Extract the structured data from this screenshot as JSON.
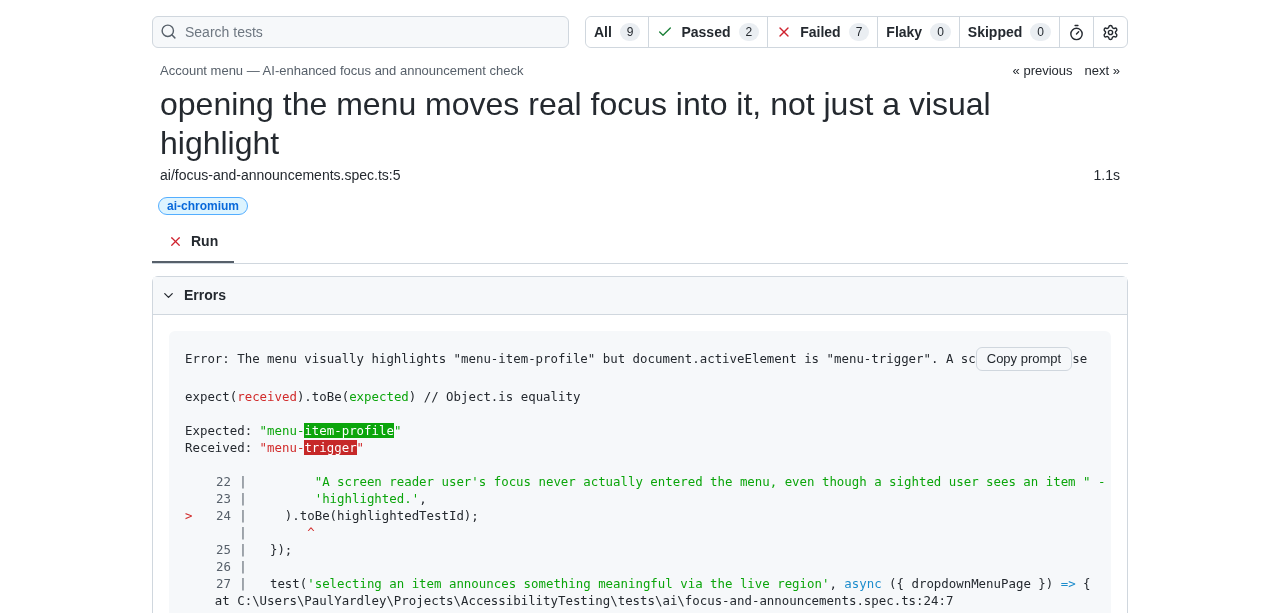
{
  "search": {
    "placeholder": "Search tests"
  },
  "filters": [
    {
      "label": "All",
      "count": "9",
      "kind": "plain",
      "selected": false
    },
    {
      "label": "Passed",
      "count": "2",
      "kind": "passed",
      "selected": false
    },
    {
      "label": "Failed",
      "count": "7",
      "kind": "failed",
      "selected": false
    },
    {
      "label": "Flaky",
      "count": "0",
      "kind": "plain",
      "selected": false
    },
    {
      "label": "Skipped",
      "count": "0",
      "kind": "plain",
      "selected": false
    }
  ],
  "breadcrumb": "Account menu — AI-enhanced focus and announcement check",
  "nav": {
    "previous": "« previous",
    "next": "next »"
  },
  "title": "opening the menu moves real focus into it, not just a visual highlight",
  "location": "ai/focus-and-announcements.spec.ts:5",
  "duration": "1.1s",
  "tags": [
    "ai-chromium"
  ],
  "tabs": [
    {
      "label": "Run",
      "kind": "failed",
      "selected": true
    }
  ],
  "errors": {
    "title": "Errors",
    "expanded": true,
    "copy_button": "Copy prompt",
    "message": "Error: The menu visually highlights \"menu-item-profile\" but document.activeElement is \"menu-trigger\". A sc",
    "message_tail": "se",
    "matcher": [
      {
        "kind": "plain",
        "text": "expect("
      },
      {
        "kind": "red",
        "text": "received"
      },
      {
        "kind": "plain",
        "text": ").toBe("
      },
      {
        "kind": "green",
        "text": "expected"
      },
      {
        "kind": "plain",
        "text": ") // Object.is equality"
      }
    ],
    "expected": [
      {
        "kind": "plain",
        "text": "Expected: "
      },
      {
        "kind": "green",
        "text": "\"menu-"
      },
      {
        "kind": "green_bg",
        "text": "item-profile"
      },
      {
        "kind": "green",
        "text": "\""
      }
    ],
    "received": [
      {
        "kind": "plain",
        "text": "Received: "
      },
      {
        "kind": "red",
        "text": "\"menu-"
      },
      {
        "kind": "red_bg",
        "text": "trigger"
      },
      {
        "kind": "red",
        "text": "\""
      }
    ],
    "code": [
      {
        "number": "22",
        "separator": "|",
        "parts": [
          {
            "kind": "green",
            "text": "        \"A screen reader user's focus never actually entered the menu, even though a sighted user sees an item \" -"
          }
        ]
      },
      {
        "number": "23",
        "separator": "|",
        "parts": [
          {
            "kind": "green",
            "text": "        'highlighted.'"
          },
          {
            "kind": "plain",
            "text": ","
          }
        ]
      },
      {
        "number": "24",
        "separator": "|",
        "current": true,
        "parts": [
          {
            "kind": "plain",
            "text": "    ).toBe(highlightedTestId);"
          }
        ]
      },
      {
        "separator": "|",
        "parts": [
          {
            "kind": "red",
            "text": "       ^"
          }
        ]
      },
      {
        "number": "25",
        "separator": "|",
        "parts": [
          {
            "kind": "plain",
            "text": "  });"
          }
        ]
      },
      {
        "number": "26",
        "separator": "|"
      },
      {
        "number": "27",
        "separator": "|",
        "parts": [
          {
            "kind": "plain",
            "text": "  test("
          },
          {
            "kind": "green",
            "text": "'selecting an item announces something meaningful via the live region'"
          },
          {
            "kind": "plain",
            "text": ", "
          },
          {
            "kind": "blue",
            "text": "async"
          },
          {
            "kind": "plain",
            "text": " ({ dropdownMenuPage }) "
          },
          {
            "kind": "blue",
            "text": "=>"
          },
          {
            "kind": "plain",
            "text": " {"
          }
        ]
      }
    ],
    "current_marker": ">",
    "stack": "    at C:\\Users\\PaulYardley\\Projects\\AccessibilityTesting\\tests\\ai\\focus-and-announcements.spec.ts:24:7"
  }
}
